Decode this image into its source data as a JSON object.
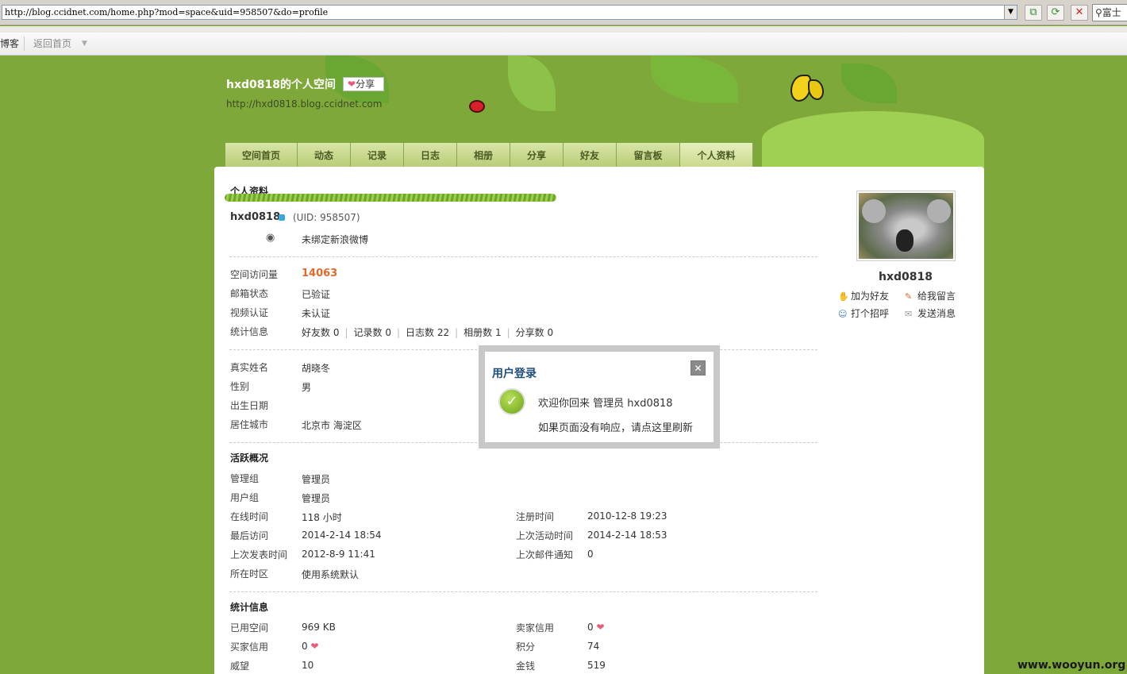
{
  "browser": {
    "url": "http://blog.ccidnet.com/home.php?mod=space&uid=958507&do=profile",
    "search_text": "富士"
  },
  "topnav": {
    "blog": "博客",
    "home": "返回首页"
  },
  "header": {
    "title": "hxd0818的个人空间",
    "share": "分享",
    "url": "http://hxd0818.blog.ccidnet.com"
  },
  "tabs": [
    "空间首页",
    "动态",
    "记录",
    "日志",
    "相册",
    "分享",
    "好友",
    "留言板",
    "个人资料"
  ],
  "profile": {
    "section_title": "个人资料",
    "username": "hxd0818",
    "uid": "(UID: 958507)",
    "weibo": "未绑定新浪微博",
    "visits_label": "空间访问量",
    "visits_value": "14063",
    "email_label": "邮箱状态",
    "email_value": "已验证",
    "video_label": "视频认证",
    "video_value": "未认证",
    "stats_label": "统计信息",
    "stats": [
      "好友数 0",
      "记录数 0",
      "日志数 22",
      "相册数 1",
      "分享数 0"
    ],
    "realname_label": "真实姓名",
    "realname_value": "胡晓冬",
    "gender_label": "性别",
    "gender_value": "男",
    "birthday_label": "出生日期",
    "city_label": "居住城市",
    "city_value": "北京市 海淀区"
  },
  "activity": {
    "title": "活跃概况",
    "group_label": "管理组",
    "group_value": "管理员",
    "usergroup_label": "用户组",
    "usergroup_value": "管理员",
    "online_label": "在线时间",
    "online_value": "118 小时",
    "register_label": "注册时间",
    "register_value": "2010-12-8 19:23",
    "lastvisit_label": "最后访问",
    "lastvisit_value": "2014-2-14 18:54",
    "lastactive_label": "上次活动时间",
    "lastactive_value": "2014-2-14 18:53",
    "lastpost_label": "上次发表时间",
    "lastpost_value": "2012-8-9 11:41",
    "lastmail_label": "上次邮件通知",
    "lastmail_value": "0",
    "timezone_label": "所在时区",
    "timezone_value": "使用系统默认"
  },
  "statistics": {
    "title": "统计信息",
    "space_label": "已用空间",
    "space_value": "969 KB",
    "seller_label": "卖家信用",
    "seller_value": "0",
    "buyer_label": "买家信用",
    "buyer_value": "0",
    "points_label": "积分",
    "points_value": "74",
    "prestige_label": "威望",
    "prestige_value": "10",
    "money_label": "金钱",
    "money_value": "519"
  },
  "sidebar": {
    "name": "hxd0818",
    "add_friend": "加为好友",
    "leave_msg": "给我留言",
    "greet": "打个招呼",
    "send_msg": "发送消息"
  },
  "modal": {
    "title": "用户登录",
    "line1": "欢迎你回来 管理员 hxd0818",
    "line2": "如果页面没有响应，请点这里刷新"
  },
  "watermark": "www.wooyun.org"
}
